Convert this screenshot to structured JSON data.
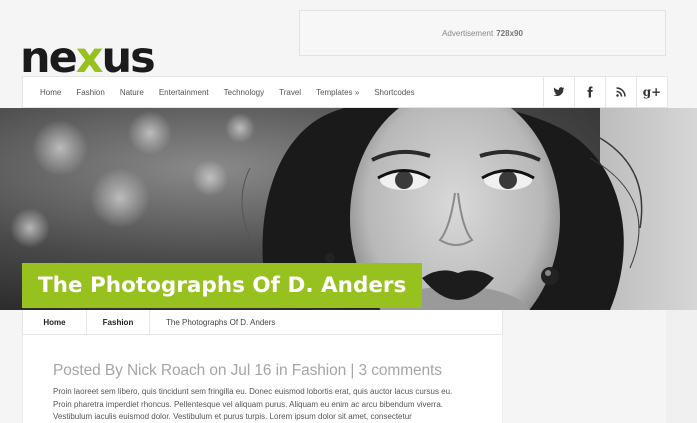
{
  "header": {
    "logo_text": "nexus",
    "ad_label": "Advertisement",
    "ad_size": "728x90"
  },
  "nav": {
    "items": [
      "Home",
      "Fashion",
      "Nature",
      "Entertainment",
      "Technology",
      "Travel",
      "Templates »",
      "Shortcodes"
    ],
    "social": [
      {
        "icon": "twitter-icon"
      },
      {
        "icon": "facebook-icon"
      },
      {
        "icon": "rss-icon"
      },
      {
        "icon": "google-plus-icon",
        "label": "g+"
      }
    ]
  },
  "hero": {
    "title": "The Photographs Of D. Anders"
  },
  "breadcrumb": {
    "home": "Home",
    "category": "Fashion",
    "current": "The Photographs Of D. Anders"
  },
  "post": {
    "meta": "Posted By Nick Roach on Jul 16 in Fashion | 3 comments",
    "body": "Proin laoreet sem libero, quis tincidunt sem fringilla eu. Donec euismod lobortis erat, quis auctor lacus cursus eu. Proin pharetra imperdiet rhoncus. Pellentesque vel aliquam purus. Aliquam eu enim ac arcu bibendum viverra. Vestibulum iaculis euismod dolor. Vestibulum et purus turpis. Lorem ipsum dolor sit amet, consectetur"
  },
  "colors": {
    "accent": "#97c11f",
    "logo_dark": "#1b1b1b"
  }
}
